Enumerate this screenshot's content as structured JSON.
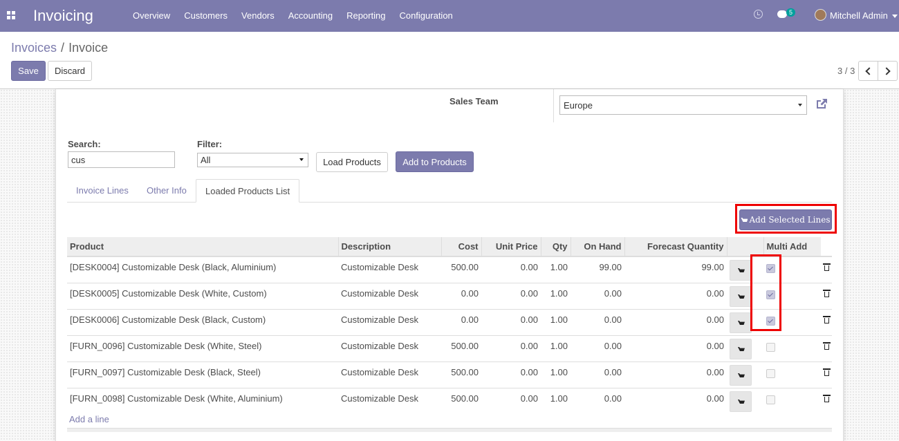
{
  "navbar": {
    "brand": "Invoicing",
    "menu": [
      "Overview",
      "Customers",
      "Vendors",
      "Accounting",
      "Reporting",
      "Configuration"
    ],
    "chat_count": "5",
    "user": "Mitchell Admin"
  },
  "control_panel": {
    "breadcrumb_parent": "Invoices",
    "breadcrumb_sep": "/",
    "breadcrumb_current": "Invoice",
    "save": "Save",
    "discard": "Discard",
    "pager": "3 / 3"
  },
  "form": {
    "sales_team_label": "Sales Team",
    "sales_team_value": "Europe",
    "search_label": "Search:",
    "search_value": "cus",
    "filter_label": "Filter:",
    "filter_value": "All",
    "load_products": "Load Products",
    "add_to_products": "Add to Products"
  },
  "tabs": [
    "Invoice Lines",
    "Other Info",
    "Loaded Products List"
  ],
  "add_selected": "Add Selected Lines",
  "table": {
    "headers": [
      "Product",
      "Description",
      "Cost",
      "Unit Price",
      "Qty",
      "On Hand",
      "Forecast Quantity",
      "",
      "Multi Add"
    ],
    "rows": [
      {
        "product": "[DESK0004] Customizable Desk (Black, Aluminium)",
        "description": "Customizable Desk",
        "cost": "500.00",
        "unit_price": "0.00",
        "qty": "1.00",
        "on_hand": "99.00",
        "forecast": "99.00",
        "checked": true
      },
      {
        "product": "[DESK0005] Customizable Desk (White, Custom)",
        "description": "Customizable Desk",
        "cost": "0.00",
        "unit_price": "0.00",
        "qty": "1.00",
        "on_hand": "0.00",
        "forecast": "0.00",
        "checked": true
      },
      {
        "product": "[DESK0006] Customizable Desk (Black, Custom)",
        "description": "Customizable Desk",
        "cost": "0.00",
        "unit_price": "0.00",
        "qty": "1.00",
        "on_hand": "0.00",
        "forecast": "0.00",
        "checked": true
      },
      {
        "product": "[FURN_0096] Customizable Desk (White, Steel)",
        "description": "Customizable Desk",
        "cost": "500.00",
        "unit_price": "0.00",
        "qty": "1.00",
        "on_hand": "0.00",
        "forecast": "0.00",
        "checked": false
      },
      {
        "product": "[FURN_0097] Customizable Desk (Black, Steel)",
        "description": "Customizable Desk",
        "cost": "500.00",
        "unit_price": "0.00",
        "qty": "1.00",
        "on_hand": "0.00",
        "forecast": "0.00",
        "checked": false
      },
      {
        "product": "[FURN_0098] Customizable Desk (White, Aluminium)",
        "description": "Customizable Desk",
        "cost": "500.00",
        "unit_price": "0.00",
        "qty": "1.00",
        "on_hand": "0.00",
        "forecast": "0.00",
        "checked": false
      }
    ],
    "add_line": "Add a line"
  },
  "colors": {
    "primary": "#7c7bad",
    "highlight": "#e00000",
    "teal_badge": "#00a09d"
  }
}
